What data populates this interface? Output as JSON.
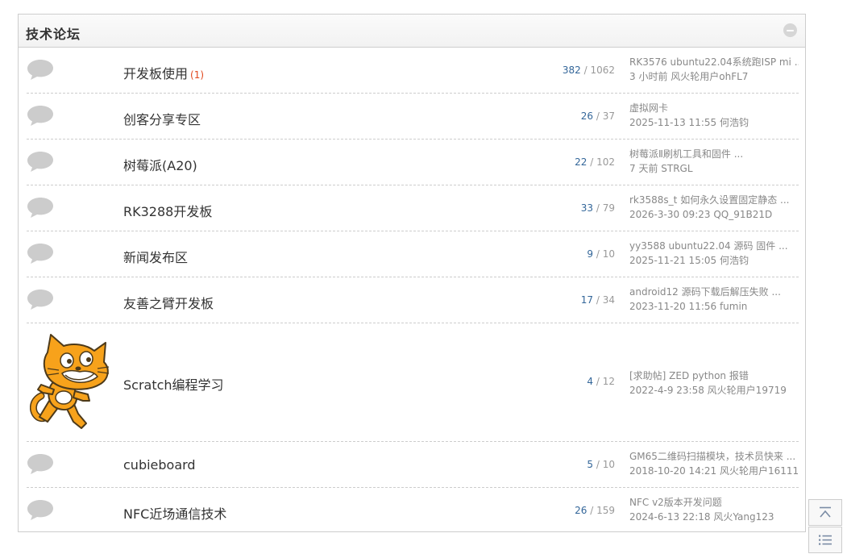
{
  "header": {
    "title": "技术论坛"
  },
  "forums": [
    {
      "name": "开发板使用",
      "today": "(1)",
      "threads": "382",
      "separator": " / ",
      "posts": "1062",
      "last_title": "RK3576 ubuntu22.04系统跑ISP mi ...",
      "last_meta": "3 小时前 风火轮用户ohFL7"
    },
    {
      "name": "创客分享专区",
      "today": "",
      "threads": "26",
      "separator": " / ",
      "posts": "37",
      "last_title": "虚拟网卡",
      "last_meta": "2025-11-13 11:55 何浩钧"
    },
    {
      "name": "树莓派(A20)",
      "today": "",
      "threads": "22",
      "separator": " / ",
      "posts": "102",
      "last_title": "树莓派Ⅱ刷机工具和固件 ...",
      "last_meta": "7 天前 STRGL"
    },
    {
      "name": "RK3288开发板",
      "today": "",
      "threads": "33",
      "separator": " / ",
      "posts": "79",
      "last_title": "rk3588s_t 如何永久设置固定静态 ...",
      "last_meta": "2026-3-30 09:23 QQ_91B21D"
    },
    {
      "name": "新闻发布区",
      "today": "",
      "threads": "9",
      "separator": " / ",
      "posts": "10",
      "last_title": "yy3588 ubuntu22.04 源码 固件 ...",
      "last_meta": "2025-11-21 15:05 何浩钧"
    },
    {
      "name": "友善之臂开发板",
      "today": "",
      "threads": "17",
      "separator": " / ",
      "posts": "34",
      "last_title": "android12 源码下载后解压失败 ...",
      "last_meta": "2023-11-20 11:56 fumin"
    },
    {
      "name": "Scratch编程学习",
      "today": "",
      "threads": "4",
      "separator": " / ",
      "posts": "12",
      "last_title": "[求助帖] ZED python 报错",
      "last_meta": "2022-4-9 23:58 风火轮用户19719"
    },
    {
      "name": "cubieboard",
      "today": "",
      "threads": "5",
      "separator": " / ",
      "posts": "10",
      "last_title": "GM65二维码扫描模块，技术员快来 ...",
      "last_meta": "2018-10-20 14:21 风火轮用户16111"
    },
    {
      "name": "NFC近场通信技术",
      "today": "",
      "threads": "26",
      "separator": " / ",
      "posts": "159",
      "last_title": "NFC v2版本开发问题",
      "last_meta": "2024-6-13 22:18 风火Yang123"
    }
  ],
  "icons": {
    "forum": "speech-bubble-icon",
    "collapse": "collapse-minus-icon",
    "back_to_top": "back-to-top-icon",
    "list": "list-icon",
    "scratch": "scratch-cat-logo"
  },
  "colors": {
    "thread_count": "#336699",
    "today_count": "#e1491e",
    "muted": "#888888",
    "bubble": "#cccccc"
  }
}
